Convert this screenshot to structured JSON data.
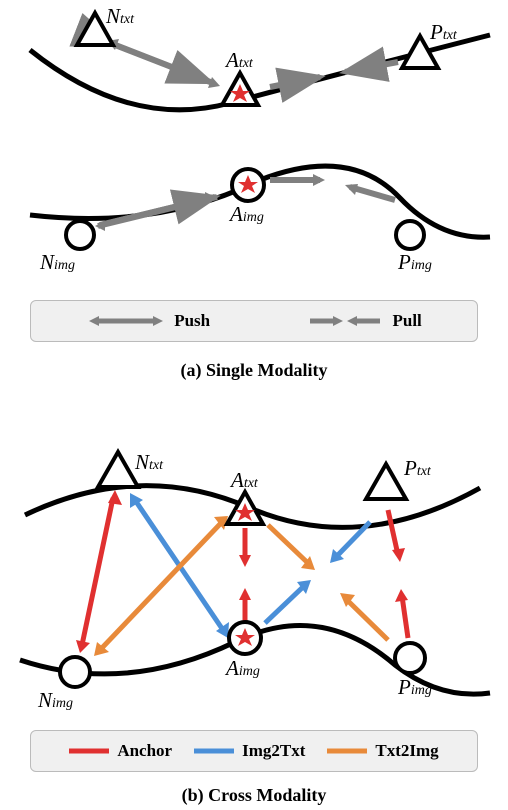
{
  "captions": {
    "a": "(a) Single Modality",
    "b": "(b) Cross Modality"
  },
  "labels": {
    "Ntxt": "N",
    "Ptxt": "P",
    "Atxt": "A",
    "Nimg": "N",
    "Pimg": "P",
    "Aimg": "A",
    "sub_txt": "txt",
    "sub_img": "img"
  },
  "legend": {
    "push": "Push",
    "pull": "Pull",
    "anchor": "Anchor",
    "img2txt": "Img2Txt",
    "txt2img": "Txt2Img"
  },
  "colors": {
    "gray": "#808080",
    "red": "#e03030",
    "blue": "#4a8fd8",
    "orange": "#e88a3a",
    "star": "#e03030",
    "black": "#000000"
  }
}
